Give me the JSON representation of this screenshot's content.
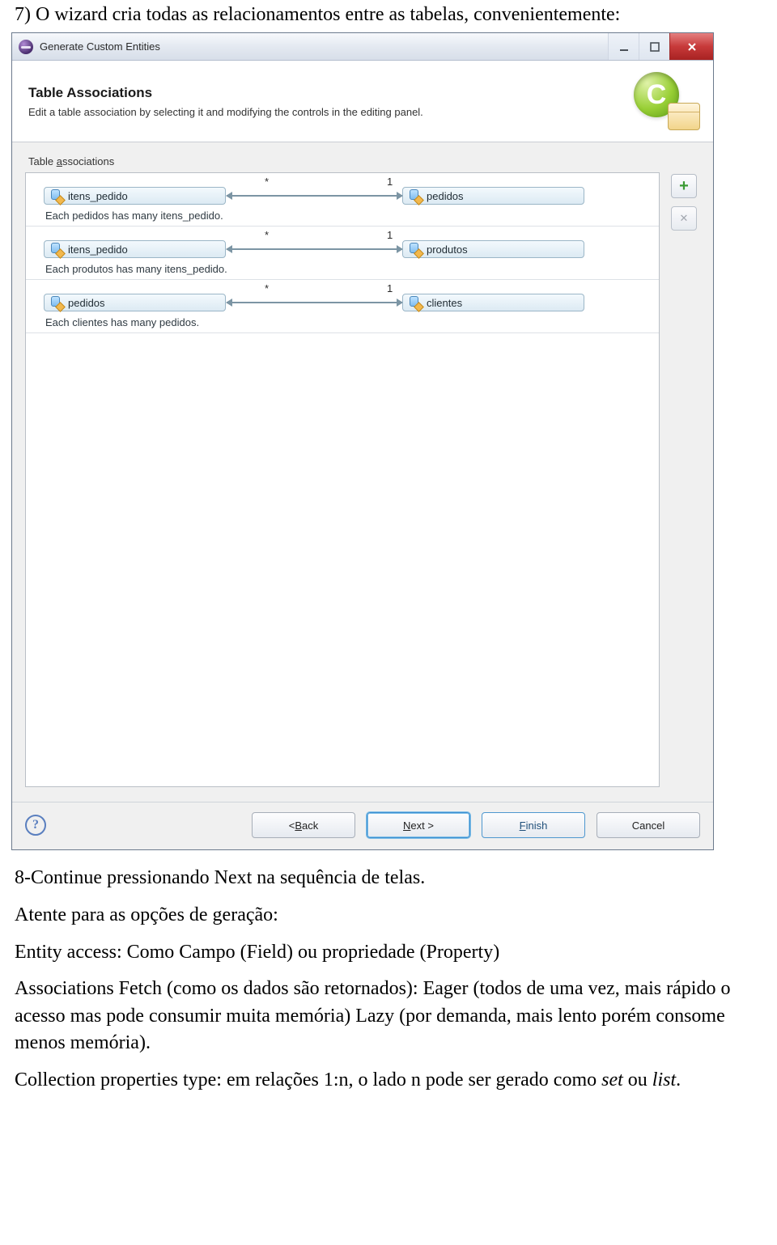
{
  "captions": {
    "top": "7) O wizard cria todas as relacionamentos  entre as tabelas, convenientemente:",
    "line1": "8-Continue pressionando Next na sequência de telas.",
    "line2": "Atente para as opções de geração:",
    "line3": "Entity access: Como Campo (Field) ou propriedade (Property)",
    "line4": "Associations Fetch (como os dados são retornados): Eager (todos de uma vez, mais rápido o acesso mas pode consumir muita memória) Lazy (por demanda, mais lento porém consome menos memória).",
    "line5_pre": "Collection properties type: em relações 1:n, o lado n pode ser gerado como ",
    "line5_em1": "set",
    "line5_mid": "  ou  ",
    "line5_em2": "list",
    "line5_post": "."
  },
  "dialog": {
    "title": "Generate Custom Entities",
    "banner_title": "Table Associations",
    "banner_sub": "Edit a table association by selecting it and modifying the controls in the editing panel.",
    "section_label_pre": "Table ",
    "section_label_accel": "a",
    "section_label_post": "ssociations",
    "cards": {
      "many": "*",
      "one": "1"
    },
    "rows": [
      {
        "left": "itens_pedido",
        "right": "pedidos",
        "desc": "Each pedidos has many itens_pedido."
      },
      {
        "left": "itens_pedido",
        "right": "produtos",
        "desc": "Each produtos has many itens_pedido."
      },
      {
        "left": "pedidos",
        "right": "clientes",
        "desc": "Each clientes has many pedidos."
      }
    ],
    "buttons": {
      "back_pre": "< ",
      "back_accel": "B",
      "back_post": "ack",
      "next_accel": "N",
      "next_post": "ext >",
      "finish_accel": "F",
      "finish_post": "inish",
      "cancel": "Cancel"
    },
    "side": {
      "add": "+",
      "remove": "✕"
    }
  }
}
